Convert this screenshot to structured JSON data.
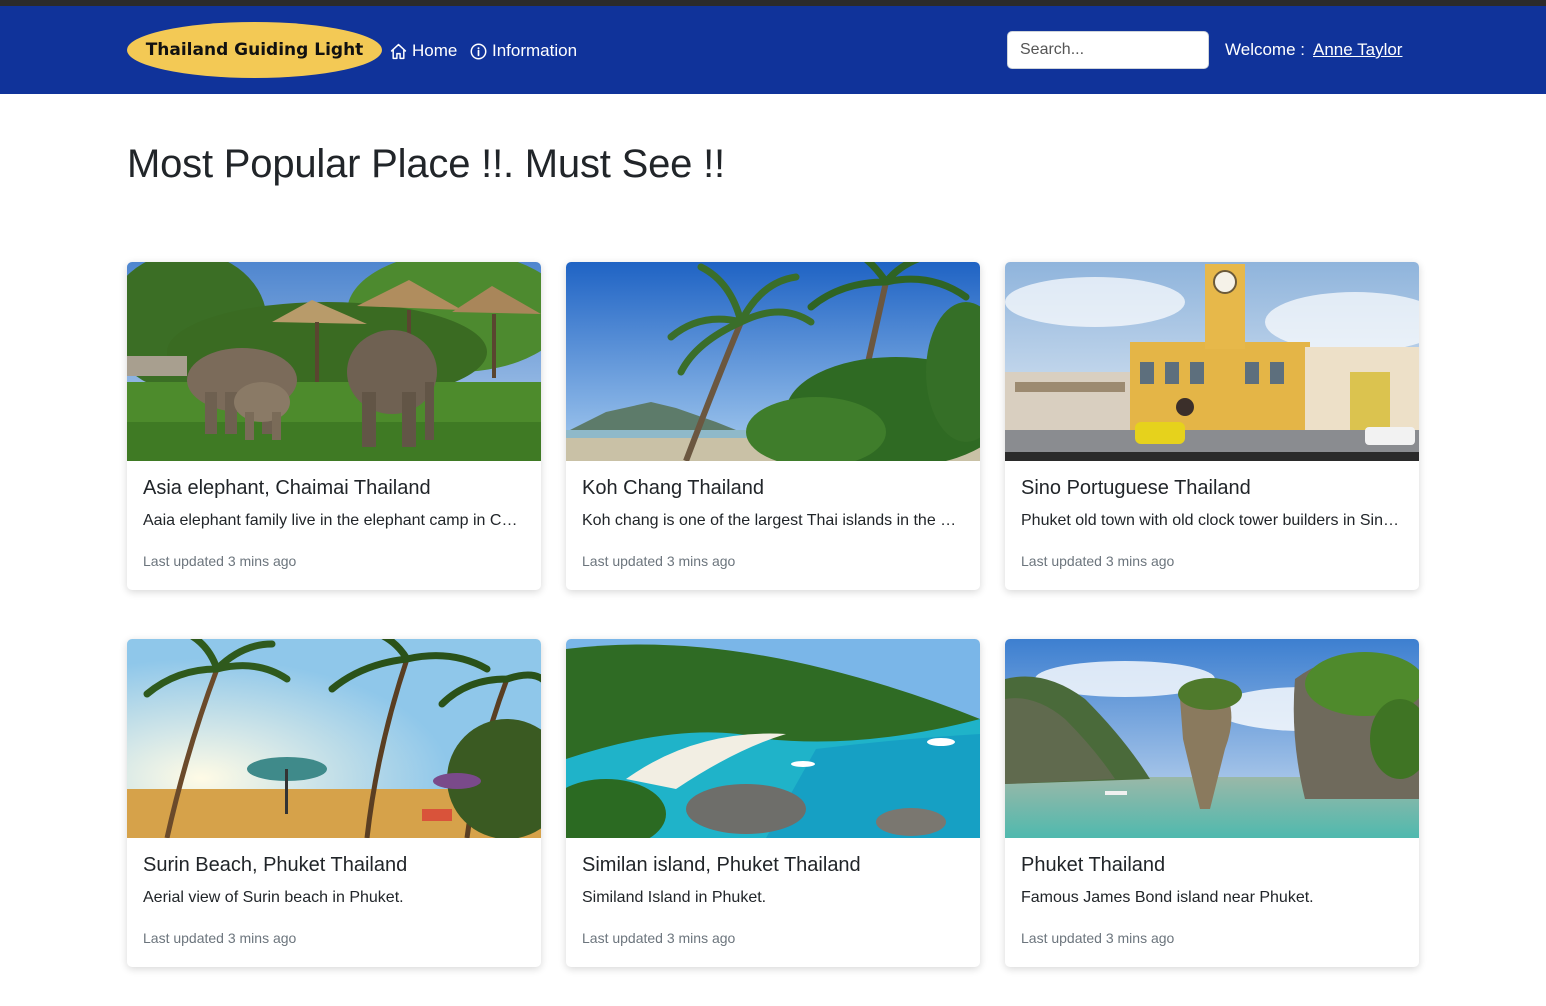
{
  "navbar": {
    "brand": "Thailand Guiding Light",
    "home_label": "Home",
    "info_label": "Information",
    "search_placeholder": "Search...",
    "welcome_label": "Welcome :",
    "username": "Anne Taylor",
    "background_color": "#10339a",
    "brand_color": "#f3c955"
  },
  "main": {
    "title": "Most Popular Place !!. Must See !!"
  },
  "cards": [
    {
      "title": "Asia elephant, Chaimai Thailand",
      "description": "Aaia elephant family live in the elephant camp in Chiangmai.",
      "updated": "Last updated 3 mins ago",
      "image": "elephant-photo"
    },
    {
      "title": "Koh Chang Thailand",
      "description": "Koh chang is one of the largest Thai islands in the Gulf of Thailand.",
      "updated": "Last updated 3 mins ago",
      "image": "palm-beach-photo"
    },
    {
      "title": "Sino Portuguese Thailand",
      "description": "Phuket old town with old clock tower builders in Sino Portuguese style.",
      "updated": "Last updated 3 mins ago",
      "image": "clock-tower-photo"
    },
    {
      "title": "Surin Beach, Phuket Thailand",
      "description": "Aerial view of Surin beach in Phuket.",
      "updated": "Last updated 3 mins ago",
      "image": "surin-beach-photo"
    },
    {
      "title": "Similan island, Phuket Thailand",
      "description": "Similand Island in Phuket.",
      "updated": "Last updated 3 mins ago",
      "image": "similan-island-photo"
    },
    {
      "title": "Phuket Thailand",
      "description": "Famous James Bond island near Phuket.",
      "updated": "Last updated 3 mins ago",
      "image": "james-bond-island-photo"
    }
  ]
}
